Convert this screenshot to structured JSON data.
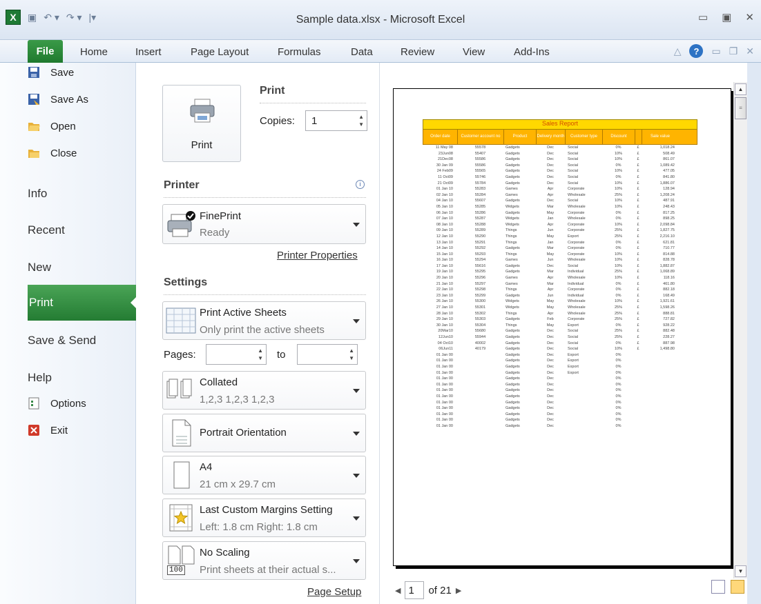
{
  "window": {
    "title": "Sample data.xlsx - Microsoft Excel"
  },
  "ribbon": {
    "tabs": [
      "File",
      "Home",
      "Insert",
      "Page Layout",
      "Formulas",
      "Data",
      "Review",
      "View",
      "Add-Ins"
    ]
  },
  "nav": {
    "commands": [
      "Save",
      "Save As",
      "Open",
      "Close"
    ],
    "tabs": [
      "Info",
      "Recent",
      "New",
      "Print",
      "Save & Send",
      "Help"
    ],
    "bottom": [
      "Options",
      "Exit"
    ]
  },
  "print": {
    "button": "Print",
    "heading": "Print",
    "copies_label": "Copies:",
    "copies_value": "1",
    "printer_heading": "Printer",
    "printer_name": "FinePrint",
    "printer_status": "Ready",
    "printer_props": "Printer Properties",
    "settings_heading": "Settings",
    "sheets_title": "Print Active Sheets",
    "sheets_sub": "Only print the active sheets",
    "pages_label": "Pages:",
    "to_label": "to",
    "collate_title": "Collated",
    "collate_sub": "1,2,3   1,2,3   1,2,3",
    "orientation": "Portrait Orientation",
    "paper_title": "A4",
    "paper_sub": "21 cm x 29.7 cm",
    "margins_title": "Last Custom Margins Setting",
    "margins_sub": "Left: 1.8 cm   Right: 1.8 cm",
    "scaling_title": "No Scaling",
    "scaling_sub": "Print sheets at their actual s...",
    "scaling_icon_text": "100",
    "page_setup": "Page Setup"
  },
  "preview": {
    "page_value": "1",
    "of_text": "of 21"
  },
  "report": {
    "title": "Sales Report",
    "headers": [
      "Order date",
      "Customer account no",
      "Product",
      "Delivery month",
      "Customer type",
      "Discount",
      "",
      "Sale value"
    ],
    "rows": [
      [
        "11 May 08",
        "55578",
        "Gadgets",
        "Dec",
        "Social",
        "0%",
        "£",
        "1,018.24"
      ],
      [
        "23Jun08",
        "55407",
        "Gadgets",
        "Dec",
        "Social",
        "10%",
        "£",
        "508.49"
      ],
      [
        "21Dec08",
        "55586",
        "Gadgets",
        "Dec",
        "Social",
        "10%",
        "£",
        "861.07"
      ],
      [
        "30 Jan 09",
        "55586",
        "Gadgets",
        "Dec",
        "Social",
        "0%",
        "£",
        "1,089.42"
      ],
      [
        "24 Feb09",
        "55565",
        "Gadgets",
        "Dec",
        "Social",
        "10%",
        "£",
        "477.05"
      ],
      [
        "11 Oct09",
        "55746",
        "Gadgets",
        "Dec",
        "Social",
        "0%",
        "£",
        "841.80"
      ],
      [
        "21 Oct09",
        "55784",
        "Gadgets",
        "Dec",
        "Social",
        "10%",
        "£",
        "1,886.07"
      ],
      [
        "01 Jan 10",
        "55283",
        "Games",
        "Apr",
        "Corporate",
        "10%",
        "£",
        "128.94"
      ],
      [
        "02 Jan 10",
        "55284",
        "Games",
        "Apr",
        "Wholesale",
        "25%",
        "£",
        "1,208.24"
      ],
      [
        "04 Jan 10",
        "55607",
        "Gadgets",
        "Dec",
        "Social",
        "10%",
        "£",
        "487.91"
      ],
      [
        "05 Jan 10",
        "55285",
        "Widgets",
        "Mar",
        "Wholesale",
        "10%",
        "£",
        "248.43"
      ],
      [
        "06 Jan 10",
        "55286",
        "Gadgets",
        "May",
        "Corporate",
        "0%",
        "£",
        "817.25"
      ],
      [
        "07 Jan 10",
        "55287",
        "Widgets",
        "Jan",
        "Wholesale",
        "0%",
        "£",
        "898.25"
      ],
      [
        "08 Jan 10",
        "55288",
        "Widgets",
        "Apr",
        "Corporate",
        "10%",
        "£",
        "2,098.84"
      ],
      [
        "09 Jan 10",
        "55289",
        "Things",
        "Jun",
        "Corporate",
        "25%",
        "£",
        "1,827.75"
      ],
      [
        "12 Jan 10",
        "55290",
        "Things",
        "May",
        "Export",
        "25%",
        "£",
        "2,216.10"
      ],
      [
        "13 Jan 10",
        "55291",
        "Things",
        "Jan",
        "Corporate",
        "0%",
        "£",
        "621.81"
      ],
      [
        "14 Jan 10",
        "55292",
        "Gadgets",
        "Mar",
        "Corporate",
        "0%",
        "£",
        "710.77"
      ],
      [
        "15 Jan 10",
        "55293",
        "Things",
        "May",
        "Corporate",
        "10%",
        "£",
        "814.88"
      ],
      [
        "16 Jan 10",
        "55294",
        "Games",
        "Jun",
        "Wholesale",
        "10%",
        "£",
        "828.78"
      ],
      [
        "17 Jan 10",
        "55616",
        "Gadgets",
        "Dec",
        "Social",
        "10%",
        "£",
        "1,882.87"
      ],
      [
        "19 Jan 10",
        "55295",
        "Gadgets",
        "Mar",
        "Individual",
        "25%",
        "£",
        "1,068.89"
      ],
      [
        "20 Jan 10",
        "55296",
        "Games",
        "Apr",
        "Wholesale",
        "10%",
        "£",
        "118.16"
      ],
      [
        "21 Jan 10",
        "55297",
        "Games",
        "Mar",
        "Individual",
        "0%",
        "£",
        "461.80"
      ],
      [
        "22 Jan 10",
        "55298",
        "Things",
        "Apr",
        "Corporate",
        "0%",
        "£",
        "882.18"
      ],
      [
        "23 Jan 10",
        "55299",
        "Gadgets",
        "Jun",
        "Individual",
        "0%",
        "£",
        "168.49"
      ],
      [
        "26 Jan 10",
        "55300",
        "Widgets",
        "May",
        "Wholesale",
        "10%",
        "£",
        "1,921.61"
      ],
      [
        "27 Jan 10",
        "55301",
        "Widgets",
        "May",
        "Wholesale",
        "25%",
        "£",
        "1,598.26"
      ],
      [
        "28 Jan 10",
        "55302",
        "Things",
        "Apr",
        "Wholesale",
        "25%",
        "£",
        "888.81"
      ],
      [
        "29 Jan 10",
        "55303",
        "Gadgets",
        "Feb",
        "Corporate",
        "25%",
        "£",
        "727.82"
      ],
      [
        "30 Jan 10",
        "55304",
        "Things",
        "May",
        "Export",
        "0%",
        "£",
        "928.22"
      ],
      [
        "20Mar10",
        "55680",
        "Gadgets",
        "Dec",
        "Social",
        "25%",
        "£",
        "882.48"
      ],
      [
        "12Jun10",
        "55944",
        "Gadgets",
        "Dec",
        "Social",
        "25%",
        "£",
        "228.27"
      ],
      [
        "04 Oct10",
        "40002",
        "Gadgets",
        "Dec",
        "Social",
        "0%",
        "£",
        "887.98"
      ],
      [
        "06Jun11",
        "40179",
        "Gadgets",
        "Dec",
        "Social",
        "10%",
        "£",
        "1,498.80"
      ],
      [
        "01 Jan 00",
        "",
        "Gadgets",
        "Dec",
        "Export",
        "0%",
        "",
        ""
      ],
      [
        "01 Jan 00",
        "",
        "Gadgets",
        "Dec",
        "Export",
        "0%",
        "",
        ""
      ],
      [
        "01 Jan 00",
        "",
        "Gadgets",
        "Dec",
        "Export",
        "0%",
        "",
        ""
      ],
      [
        "01 Jan 00",
        "",
        "Gadgets",
        "Dec",
        "Export",
        "0%",
        "",
        ""
      ],
      [
        "01 Jan 00",
        "",
        "Gadgets",
        "Dec",
        "",
        "0%",
        "",
        ""
      ],
      [
        "01 Jan 00",
        "",
        "Gadgets",
        "Dec",
        "",
        "0%",
        "",
        ""
      ],
      [
        "01 Jan 00",
        "",
        "Gadgets",
        "Dec",
        "",
        "0%",
        "",
        ""
      ],
      [
        "01 Jan 00",
        "",
        "Gadgets",
        "Dec",
        "",
        "0%",
        "",
        ""
      ],
      [
        "01 Jan 00",
        "",
        "Gadgets",
        "Dec",
        "",
        "0%",
        "",
        ""
      ],
      [
        "01 Jan 00",
        "",
        "Gadgets",
        "Dec",
        "",
        "0%",
        "",
        ""
      ],
      [
        "01 Jan 00",
        "",
        "Gadgets",
        "Dec",
        "",
        "0%",
        "",
        ""
      ],
      [
        "01 Jan 00",
        "",
        "Gadgets",
        "Dec",
        "",
        "0%",
        "",
        ""
      ],
      [
        "01 Jan 00",
        "",
        "Gadgets",
        "Dec",
        "",
        "0%",
        "",
        ""
      ]
    ]
  },
  "colors": {
    "file_tab": "#247c33",
    "report_title_bg": "#ffd800",
    "report_header_bg": "#ffb400"
  }
}
